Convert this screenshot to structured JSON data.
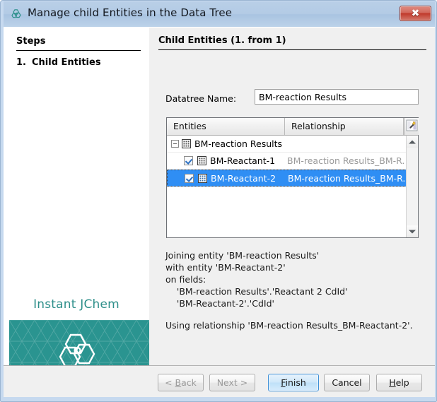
{
  "window": {
    "title": "Manage child Entities in the Data Tree",
    "app_icon": "molecule-hexagon-icon",
    "close_label": "✖"
  },
  "sidebar": {
    "steps_heading": "Steps",
    "steps": [
      {
        "number": "1.",
        "label": "Child Entities"
      }
    ],
    "brand": {
      "name": "Instant JChem",
      "logo_icon": "hexagon-molecule-logo",
      "panel_color": "#2a9490",
      "text_color": "#2e8f8a"
    }
  },
  "main": {
    "title": "Child Entities (1. from 1)",
    "datatree": {
      "label": "Datatree Name:",
      "value": "BM-reaction Results",
      "placeholder": ""
    },
    "table": {
      "columns": [
        "Entities",
        "Relationship"
      ],
      "header_button_icon": "column-chooser-wand-icon",
      "rows": [
        {
          "entity": "BM-reaction Results",
          "relationship": "",
          "level": 0,
          "expander": "minus",
          "checkbox": null,
          "selected": false,
          "icon": "grid-table-icon"
        },
        {
          "entity": "BM-Reactant-1",
          "relationship": "BM-reaction Results_BM-R...",
          "level": 1,
          "expander": null,
          "checkbox": "checked",
          "selected": false,
          "icon": "grid-table-icon"
        },
        {
          "entity": "BM-Reactant-2",
          "relationship": "BM-reaction Results_BM-R...",
          "level": 1,
          "expander": null,
          "checkbox": "checked",
          "selected": true,
          "icon": "grid-table-icon"
        }
      ],
      "scrollbar": {
        "up_icon": "scroll-up-arrow-icon",
        "down_icon": "scroll-down-arrow-icon"
      }
    },
    "info_block_1": "Joining entity 'BM-reaction Results'\nwith entity 'BM-Reactant-2'\non fields:\n    'BM-reaction Results'.'Reactant 2 CdId'\n    'BM-Reactant-2'.'CdId'",
    "info_block_2": "Using relationship 'BM-reaction Results_BM-Reactant-2'."
  },
  "buttons": {
    "back": {
      "label": "< Back",
      "mnemonic": "B",
      "disabled": true,
      "primary": false
    },
    "next": {
      "label": "Next >",
      "mnemonic": "",
      "disabled": true,
      "primary": false
    },
    "finish": {
      "label": "Finish",
      "mnemonic": "F",
      "disabled": false,
      "primary": true
    },
    "cancel": {
      "label": "Cancel",
      "mnemonic": "",
      "disabled": false,
      "primary": false
    },
    "help": {
      "label": "Help",
      "mnemonic": "H",
      "disabled": false,
      "primary": false
    }
  }
}
